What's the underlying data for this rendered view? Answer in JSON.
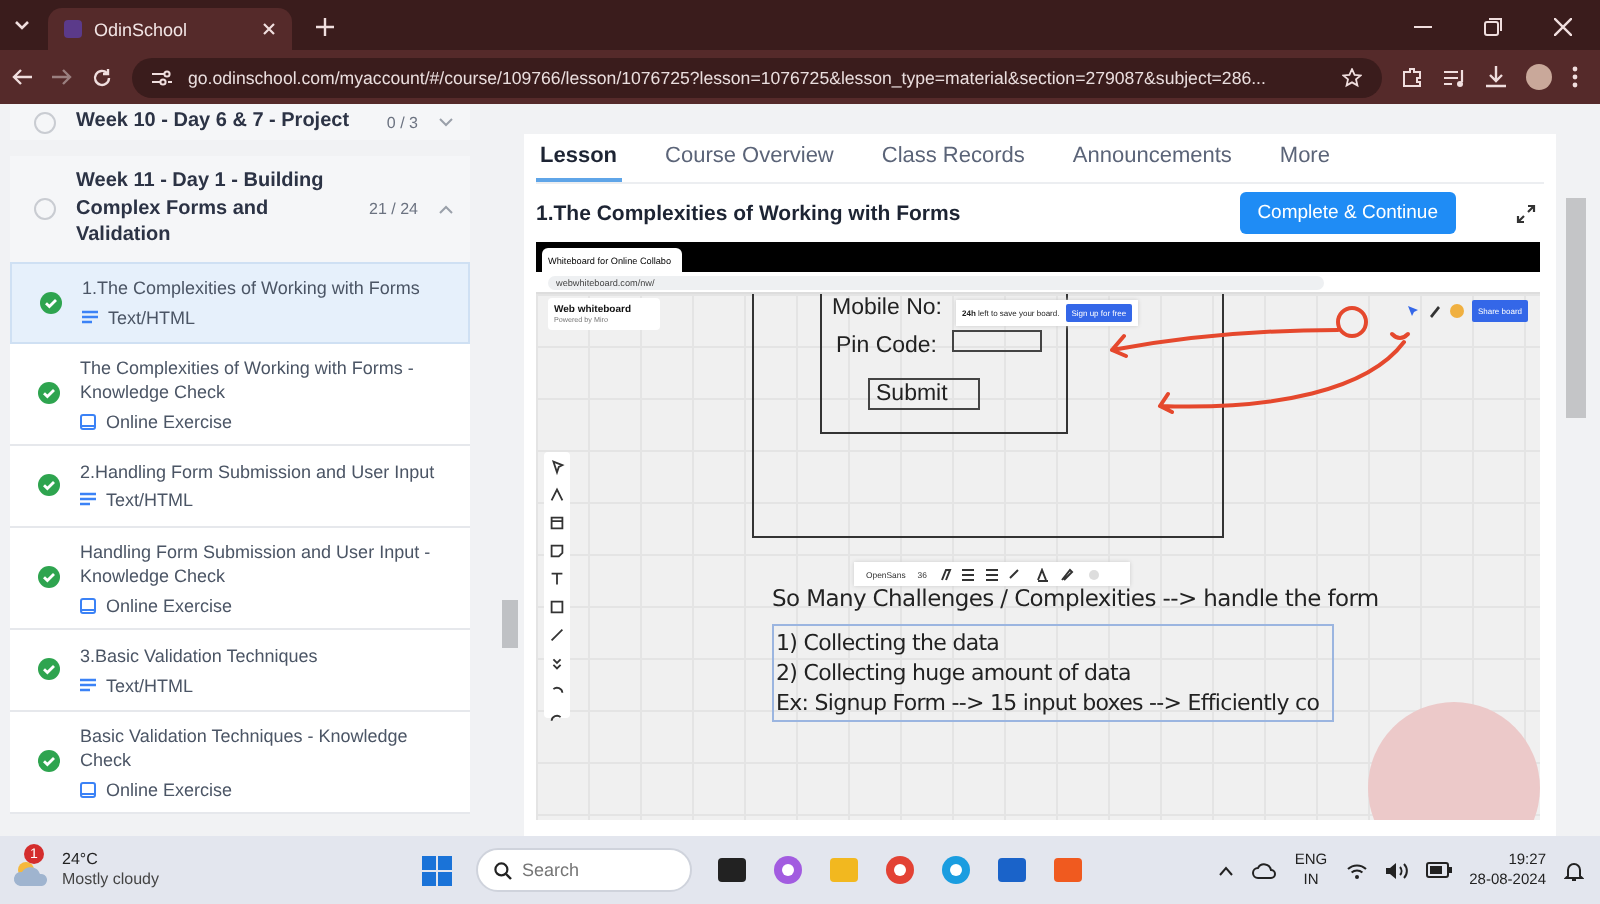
{
  "browser": {
    "tab_title": "OdinSchool",
    "url": "go.odinschool.com/myaccount/#/course/109766/lesson/1076725?lesson=1076725&lesson_type=material&section=279087&subject=286..."
  },
  "sidebar": {
    "sections": [
      {
        "title": "Week 10 - Day 6 & 7 - Project",
        "count": "0 / 3",
        "expanded": false
      },
      {
        "title": "Week 11 - Day 1 - Building Complex Forms and Validation",
        "count": "21 / 24",
        "expanded": true,
        "items": [
          {
            "title": "1.The Complexities of Working with Forms",
            "type": "Text/HTML",
            "kind": "text",
            "completed": true,
            "selected": true
          },
          {
            "title": "The Complexities of Working with Forms - Knowledge Check",
            "type": "Online Exercise",
            "kind": "exercise",
            "completed": true,
            "selected": false
          },
          {
            "title": "2.Handling Form Submission and User Input",
            "type": "Text/HTML",
            "kind": "text",
            "completed": true,
            "selected": false
          },
          {
            "title": "Handling Form Submission and User Input - Knowledge Check",
            "type": "Online Exercise",
            "kind": "exercise",
            "completed": true,
            "selected": false
          },
          {
            "title": "3.Basic Validation Techniques",
            "type": "Text/HTML",
            "kind": "text",
            "completed": true,
            "selected": false
          },
          {
            "title": "Basic Validation Techniques - Knowledge Check",
            "type": "Online Exercise",
            "kind": "exercise",
            "completed": true,
            "selected": false
          }
        ]
      }
    ]
  },
  "lesson": {
    "tabs": [
      {
        "label": "Lesson",
        "selected": true
      },
      {
        "label": "Course Overview",
        "selected": false
      },
      {
        "label": "Class Records",
        "selected": false
      },
      {
        "label": "Announcements",
        "selected": false
      },
      {
        "label": "More",
        "selected": false
      }
    ],
    "title": "1.The Complexities of Working with Forms",
    "primary_button": "Complete & Continue"
  },
  "video": {
    "tab_title": "Whiteboard for Online Collabo",
    "url": "webwhiteboard.com/nw/",
    "board_name": "Web whiteboard",
    "board_subtitle": "Powered by Miro",
    "toast": "**24h** left to save your board.",
    "signup_button": "Sign up for free",
    "share_button": "Share board",
    "form_labels": [
      "Mobile No:",
      "Pin Code:"
    ],
    "submit_label": "Submit",
    "font_name": "OpenSans",
    "font_size": "36",
    "heading": "So Many Challenges / Complexities --> handle the form",
    "lines": [
      "1) Collecting the data",
      "2) Collecting huge amount of data",
      "Ex: Signup Form --> 15 input boxes --> Efficiently co"
    ]
  },
  "taskbar": {
    "weather_badge": "1",
    "temperature": "24°C",
    "condition": "Mostly cloudy",
    "search_placeholder": "Search",
    "language": "ENG",
    "region": "IN",
    "time": "19:27",
    "date": "28-08-2024"
  }
}
